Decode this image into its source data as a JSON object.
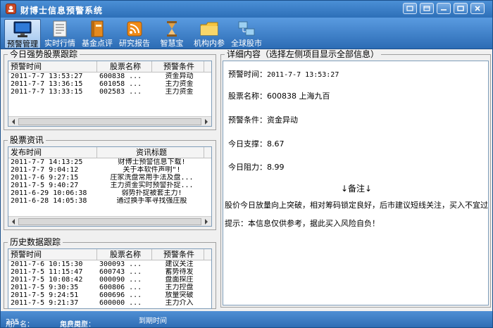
{
  "app": {
    "title": "财博士信息预警系统"
  },
  "toolbar": {
    "items": [
      {
        "label": "预警管理",
        "icon": "monitor-icon",
        "active": true
      },
      {
        "label": "实时行情",
        "icon": "document-icon"
      },
      {
        "label": "基金点评",
        "icon": "book-icon"
      },
      {
        "label": "研究报告",
        "icon": "rss-icon"
      },
      {
        "label": "智慧宝",
        "icon": "hourglass-icon"
      },
      {
        "label": "机构内参",
        "icon": "folder-icon"
      },
      {
        "label": "全球股市",
        "icon": "network-icon"
      }
    ]
  },
  "strong": {
    "title": "今日强势股票跟踪",
    "headers": [
      "预警时间",
      "股票名称",
      "预警条件"
    ],
    "rows": [
      [
        "2011-7-7 13:53:27",
        "600838 ...",
        "资金异动"
      ],
      [
        "2011-7-7 13:36:15",
        "601058 ...",
        "主力资金"
      ],
      [
        "2011-7-7 13:33:15",
        "002583 ...",
        "主力资金"
      ]
    ]
  },
  "news": {
    "title": "股票资讯",
    "headers": [
      "发布时间",
      "资讯标题"
    ],
    "rows": [
      [
        "2011-7-7 14:13:25",
        "财博士预警信息下载!"
      ],
      [
        "2011-7-7 9:04:12",
        "关于本软件声明\"!"
      ],
      [
        "2011-7-6 9:27:15",
        "庄家洗盘常用手法及盘..."
      ],
      [
        "2011-7-5 9:40:27",
        "主力资金实时预警扑捉..."
      ],
      [
        "2011-6-29 10:06:38",
        "弱势扑捉被套主力!"
      ],
      [
        "2011-6-28 14:05:38",
        "通过换手率寻找强庄股"
      ]
    ]
  },
  "history": {
    "title": "历史数据跟踪",
    "headers": [
      "预警时间",
      "股票名称",
      "预警条件"
    ],
    "rows": [
      [
        "2011-7-6 10:15:30",
        "300093 ...",
        "建议关注"
      ],
      [
        "2011-7-5 11:15:47",
        "600743 ...",
        "蓄势待发"
      ],
      [
        "2011-7-5 10:08:42",
        "000090 ...",
        "盘面探庄"
      ],
      [
        "2011-7-5 9:30:35",
        "600806 ...",
        "主力控盘"
      ],
      [
        "2011-7-5 9:24:51",
        "600696 ...",
        "放量突破"
      ],
      [
        "2011-7-5 9:21:37",
        "600000 ...",
        "主力介入"
      ]
    ]
  },
  "detail": {
    "title": "详细内容（选择左侧项目显示全部信息）",
    "time_label": "预警时间：",
    "time": "2011-7-7 13:53:27",
    "name_label": "股票名称：",
    "name": "600838 上海九百",
    "cond_label": "预警条件：",
    "cond": "资金异动",
    "support_label": "今日支撑：",
    "support": "8.67",
    "resist_label": "今日阻力：",
    "resist": "8.99",
    "remark": "↓备注↓",
    "note": "股价今日放量向上突破，相对筹码锁定良好，后市建议短线关注，买入不宜过多",
    "tip": "提示：本信息仅供参考，据此买入风险自负！"
  },
  "status": {
    "user_label": "用户名：",
    "user": "235",
    "type_label": "用户类型：",
    "type": "免费用户",
    "expire_label": "到期时间"
  }
}
